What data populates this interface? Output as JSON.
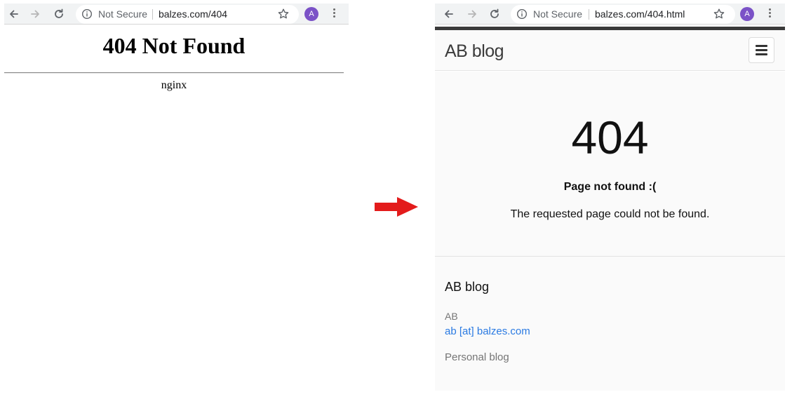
{
  "left_browser": {
    "security_label": "Not Secure",
    "url": "balzes.com/404",
    "avatar_letter": "A"
  },
  "left_page": {
    "title": "404 Not Found",
    "server": "nginx"
  },
  "arrow": {
    "color": "#e31b1b"
  },
  "right_browser": {
    "security_label": "Not Secure",
    "url": "balzes.com/404.html",
    "avatar_letter": "A"
  },
  "right_page": {
    "brand": "AB blog",
    "error_code": "404",
    "error_heading": "Page not found :(",
    "error_message": "The requested page could not be found.",
    "footer": {
      "title": "AB blog",
      "author": "AB",
      "email": "ab [at] balzes.com",
      "description": "Personal blog"
    }
  },
  "colors": {
    "avatar": "#7b52c7",
    "link": "#2a7ae2",
    "toolbar": "#f1f3f4"
  }
}
